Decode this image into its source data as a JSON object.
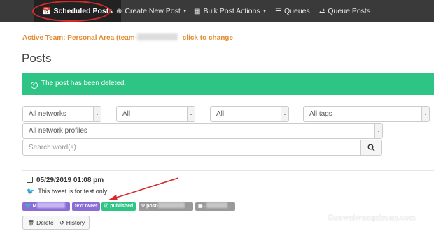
{
  "nav": {
    "scheduled_posts": "Scheduled Posts",
    "create_new_post": "Create New Post",
    "bulk_post_actions": "Bulk Post Actions",
    "queues": "Queues",
    "queue_posts": "Queue Posts"
  },
  "active_team": {
    "prefix": "Active Team: Personal Area (team-",
    "link": "click to change"
  },
  "page_title": "Posts",
  "alert": {
    "message": "The post has been deleted."
  },
  "filters": {
    "networks": "All networks",
    "all_1": "All",
    "all_2": "All",
    "tags": "All tags",
    "network_profiles": "All network profiles",
    "search_placeholder": "Search word(s)"
  },
  "post": {
    "date": "05/29/2019 01:08 pm",
    "text": "This tweet is for test only.",
    "badges": {
      "profile_initial": "M",
      "type": "text tweet",
      "status": "published",
      "post_prefix": "post-",
      "owner_initial": "J"
    },
    "actions": {
      "delete": "Delete",
      "history": "History"
    }
  },
  "watermark": "Guowaiwangzhuan.com",
  "colors": {
    "navbar": "#3a3a3a",
    "accent_orange": "#e38a2e",
    "success_green": "#2ec486",
    "badge_purple": "#8a6ed6",
    "annotation_red": "#d42a2a"
  },
  "icons": {
    "scheduled_posts": "calendar-icon",
    "create_new_post": "plus-circle-icon",
    "bulk_post_actions": "grid-icon",
    "queues": "list-icon",
    "queue_posts": "refresh-icon",
    "search": "search-icon",
    "delete": "trash-icon",
    "history": "history-icon"
  }
}
